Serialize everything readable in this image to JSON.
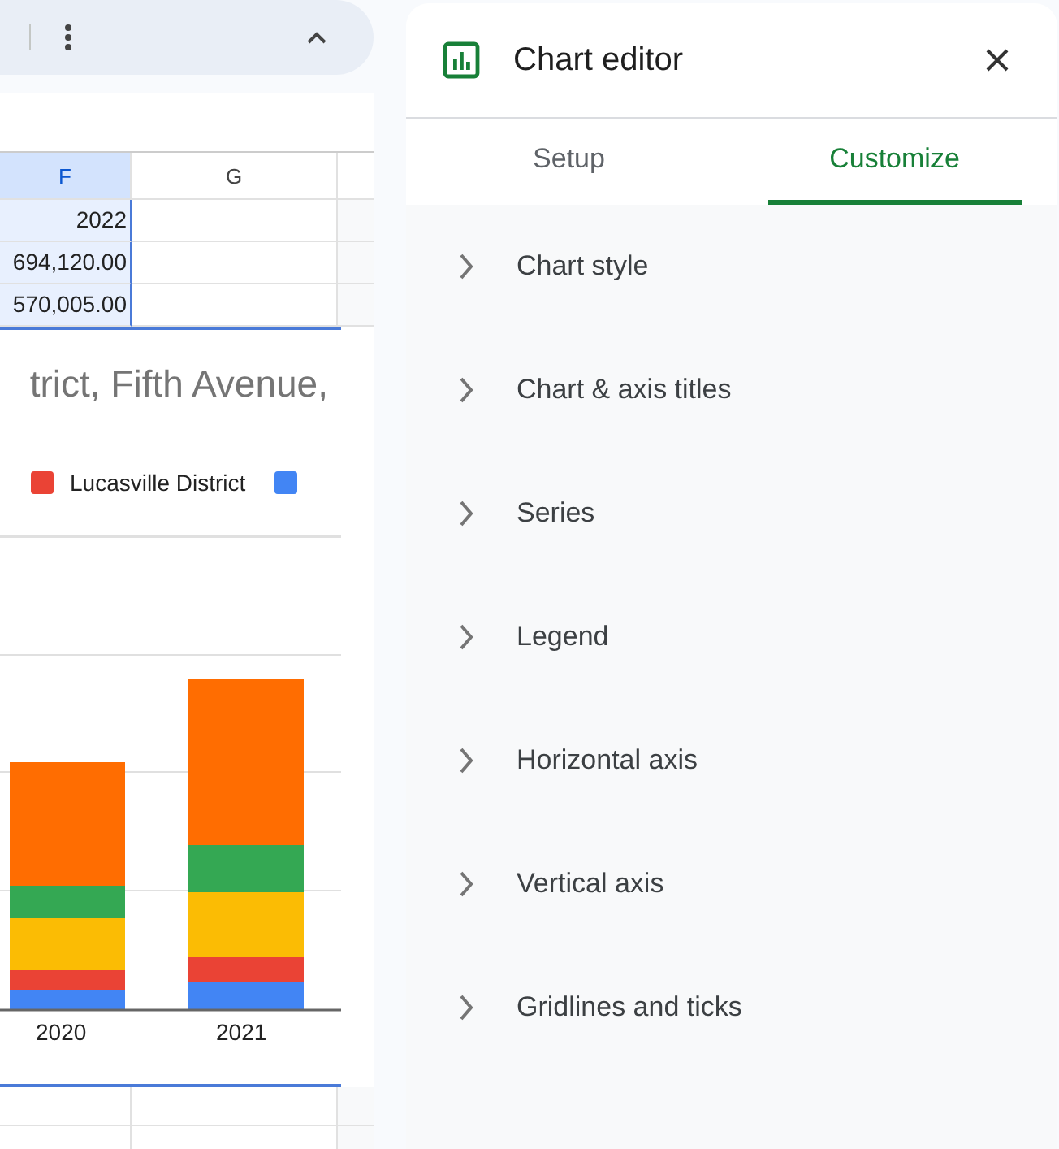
{
  "sheet": {
    "columns": [
      {
        "label": "F",
        "selected": true
      },
      {
        "label": "G",
        "selected": false
      }
    ],
    "rows": [
      [
        "2022",
        ""
      ],
      [
        "694,120.00",
        ""
      ],
      [
        "570,005.00",
        ""
      ]
    ]
  },
  "chart": {
    "title": "trict, Fifth Avenue,",
    "legend": [
      {
        "label": "Lucasville District",
        "color": "#ea4335"
      },
      {
        "color": "#4285f4"
      }
    ],
    "x_labels": [
      "2020",
      "2021"
    ]
  },
  "editor": {
    "title": "Chart editor",
    "tabs": [
      {
        "label": "Setup",
        "selected": false
      },
      {
        "label": "Customize",
        "selected": true
      }
    ],
    "sections": [
      {
        "label": "Chart style",
        "expanded": false
      },
      {
        "label": "Chart & axis titles",
        "expanded": false
      },
      {
        "label": "Series",
        "expanded": false
      },
      {
        "label": "Legend",
        "expanded": false
      },
      {
        "label": "Horizontal axis",
        "expanded": false
      },
      {
        "label": "Vertical axis",
        "expanded": false
      },
      {
        "label": "Gridlines and ticks",
        "expanded": false
      }
    ]
  }
}
